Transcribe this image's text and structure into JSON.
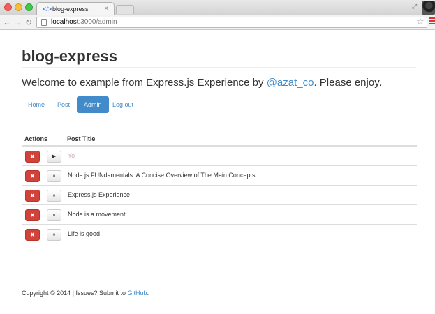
{
  "browser": {
    "tab_title": "blog-express",
    "tab_close": "×",
    "url_host": "localhost",
    "url_rest": ":3000/admin"
  },
  "site": {
    "brand": "blog-express",
    "welcome_prefix": "Welcome to example from Express.js Experience by ",
    "welcome_link": "@azat_co",
    "welcome_suffix": ". Please enjoy.",
    "nav": [
      "Home",
      "Post",
      "Admin",
      "Log out"
    ],
    "active_nav": "Admin"
  },
  "table": {
    "headers": [
      "Actions",
      "Post Title"
    ],
    "rows": [
      {
        "title": "Yo",
        "published": false,
        "delete": "✖",
        "toggle": "▶"
      },
      {
        "title": "Node.js FUNdamentals: A Concise Overview of The Main Concepts",
        "published": true,
        "delete": "✖",
        "toggle": "⏸"
      },
      {
        "title": "Express.js Experience",
        "published": true,
        "delete": "✖",
        "toggle": "⏸"
      },
      {
        "title": "Node is a movement",
        "published": true,
        "delete": "✖",
        "toggle": "⏸"
      },
      {
        "title": "Life is good",
        "published": true,
        "delete": "✖",
        "toggle": "⏸"
      }
    ]
  },
  "footer": {
    "prefix": "Copyright © 2014 | Issues? Submit to ",
    "link": "GitHub",
    "suffix": "."
  },
  "colors": {
    "link": "#428bca",
    "danger": "#d2423a",
    "unpublished": "#c9aeb0"
  }
}
